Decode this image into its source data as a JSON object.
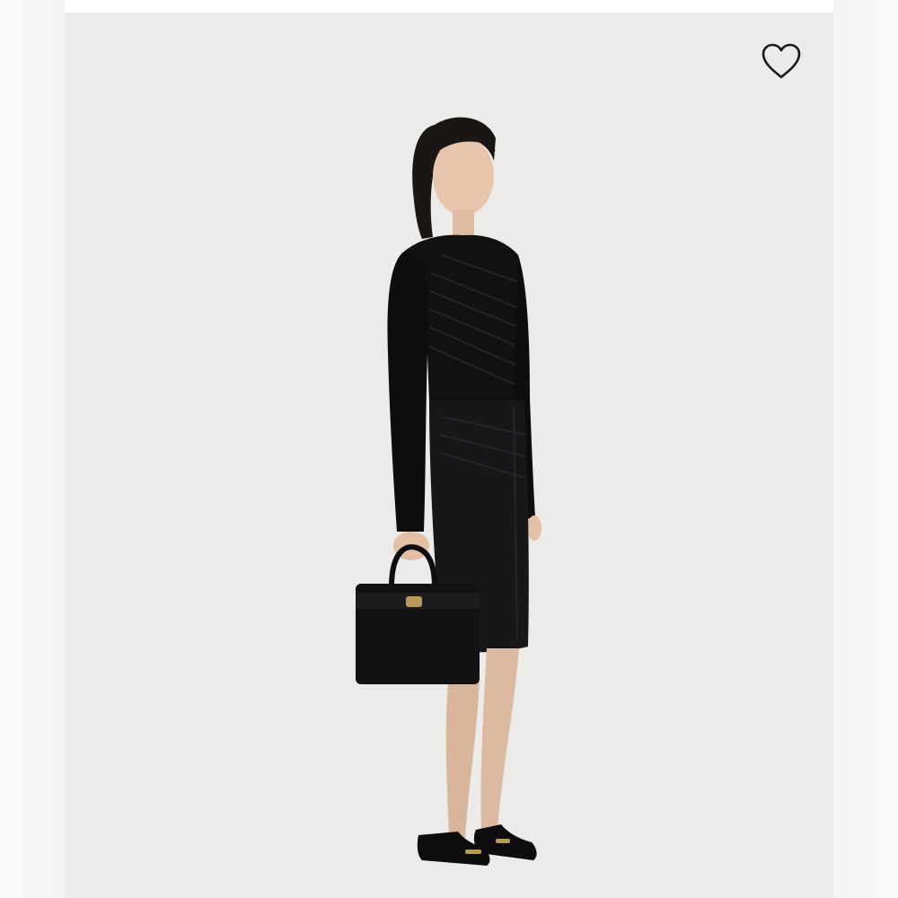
{
  "product": {
    "image_alt": "",
    "background_color": "#ebebe9",
    "favorite": {
      "icon": "heart-outline-icon",
      "state": "not-favorited"
    }
  }
}
